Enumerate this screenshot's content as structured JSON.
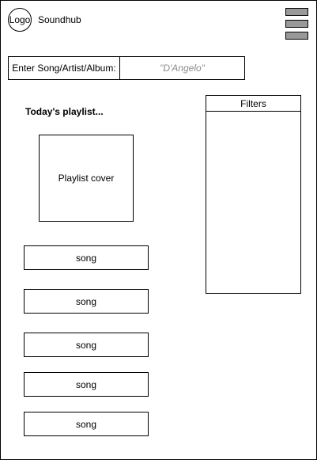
{
  "header": {
    "logo_label": "Logo",
    "app_title": "Soundhub",
    "menu_icon": "hamburger-menu-icon",
    "menu_bar_color": "#999999"
  },
  "search": {
    "label": "Enter Song/Artist/Album:",
    "placeholder": "\"D'Angelo\""
  },
  "playlist": {
    "heading": "Today's playlist...",
    "cover_label": "Playlist cover"
  },
  "filters": {
    "title": "Filters"
  },
  "songs": [
    {
      "label": "song"
    },
    {
      "label": "song"
    },
    {
      "label": "song"
    },
    {
      "label": "song"
    },
    {
      "label": "song"
    }
  ]
}
